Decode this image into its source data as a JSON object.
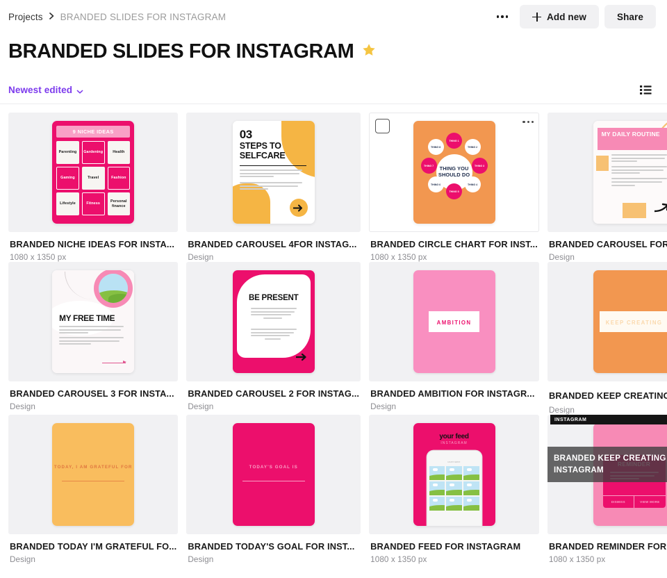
{
  "breadcrumb": {
    "root": "Projects",
    "separator": "›",
    "current": "BRANDED SLIDES FOR INSTAGRAM"
  },
  "header": {
    "more_label": "",
    "add_new_label": "Add new",
    "share_label": "Share",
    "title": "BRANDED SLIDES FOR INSTAGRAM",
    "star_color": "#f5c542"
  },
  "toolbar": {
    "sort_label": "Newest edited",
    "sort_color": "#7c3aed",
    "view_mode": "list-view-icon"
  },
  "tooltip": {
    "text": "BRANDED KEEP CREATING FOR INSTAGRAM"
  },
  "cards": [
    {
      "title": "BRANDED NICHE IDEAS FOR INSTA...",
      "subtitle": "1080 x 1350 px",
      "art": "niche",
      "selected": false,
      "heading": "9 NICHE IDEAS",
      "cells": [
        {
          "label": "Parenting",
          "style": "light"
        },
        {
          "label": "Gardening",
          "style": "dark"
        },
        {
          "label": "Health",
          "style": "light"
        },
        {
          "label": "Gaming",
          "style": "dark"
        },
        {
          "label": "Travel",
          "style": "light"
        },
        {
          "label": "Fashion",
          "style": "dark"
        },
        {
          "label": "Lifestyle",
          "style": "light"
        },
        {
          "label": "Fitness",
          "style": "dark"
        },
        {
          "label": "Personal finance",
          "style": "light"
        }
      ]
    },
    {
      "title": "BRANDED CAROUSEL 4FOR INSTAG...",
      "subtitle": "Design",
      "art": "selfcare",
      "selected": false,
      "number": "03",
      "heading": "STEPS TO SELFCARE"
    },
    {
      "title": "BRANDED CIRCLE CHART FOR INST...",
      "subtitle": "1080 x 1350 px",
      "art": "circle-chart",
      "selected": true,
      "hub": "THING YOU SHOULD DO",
      "nodes": [
        "THING 1",
        "THING 2",
        "THING 3",
        "THING 4",
        "THING 5",
        "THING 6",
        "THING 7",
        "THING 8"
      ]
    },
    {
      "title": "BRANDED CAROUSEL FOR INSTAGR...",
      "subtitle": "Design",
      "art": "daily-routine",
      "selected": false,
      "heading": "MY DAILY ROUTINE"
    },
    {
      "title": "BRANDED CAROUSEL 3 FOR INSTA...",
      "subtitle": "Design",
      "art": "free-time",
      "selected": false,
      "heading": "MY FREE TIME"
    },
    {
      "title": "BRANDED CAROUSEL 2 FOR INSTAG...",
      "subtitle": "Design",
      "art": "be-present",
      "selected": false,
      "heading": "BE PRESENT"
    },
    {
      "title": "BRANDED AMBITION FOR INSTAGR...",
      "subtitle": "Design",
      "art": "ambition",
      "selected": false,
      "heading": "AMBITION"
    },
    {
      "title": "BRANDED KEEP CREATING FOR ...",
      "subtitle": "Design",
      "art": "keep-creating",
      "selected": false,
      "editable": true,
      "heading": "KEEP CREATING"
    },
    {
      "title": "BRANDED TODAY I'M GRATEFUL FO...",
      "subtitle": "Design",
      "art": "grateful",
      "selected": false,
      "heading": "TODAY, I AM GRATEFUL FOR"
    },
    {
      "title": "BRANDED TODAY'S GOAL FOR INST...",
      "subtitle": "Design",
      "art": "todays-goal",
      "selected": false,
      "heading": "TODAY'S GOAL IS"
    },
    {
      "title": "BRANDED FEED FOR INSTAGRAM",
      "subtitle": "1080 x 1350 px",
      "art": "feed",
      "selected": false,
      "heading": "your feed",
      "subheading": "INSTAGRAM"
    },
    {
      "title": "BRANDED REMINDER FOR INSTAGR...",
      "subtitle": "1080 x 1350 px",
      "art": "reminder",
      "selected": false,
      "banner": "INSTAGRAM",
      "heading": "REMINDER",
      "buttons": [
        "DISMISS",
        "VIEW MORE"
      ]
    }
  ]
}
